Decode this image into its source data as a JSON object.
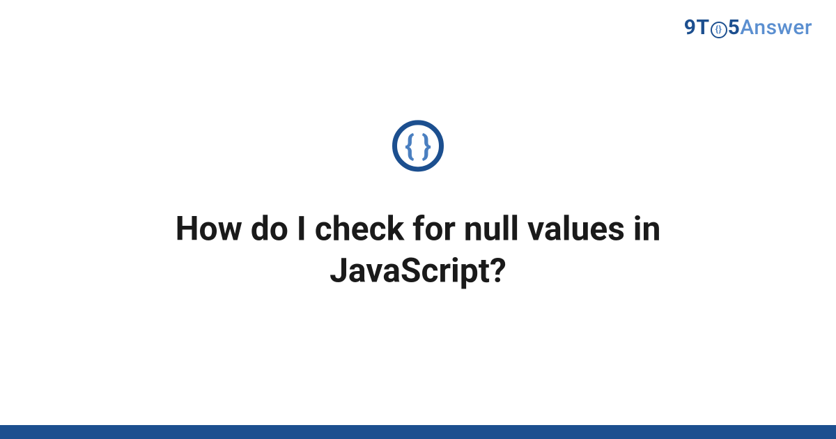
{
  "brand": {
    "part1": "9T",
    "circle_inner": "{}",
    "part2": "5",
    "part3": "Answer"
  },
  "topic_icon": {
    "glyph": "{ }",
    "name": "code-braces-icon"
  },
  "question": {
    "title": "How do I check for null values in JavaScript?"
  },
  "colors": {
    "primary": "#1c4f8f",
    "secondary": "#5b8fd0",
    "accent": "#4a7fc0"
  }
}
